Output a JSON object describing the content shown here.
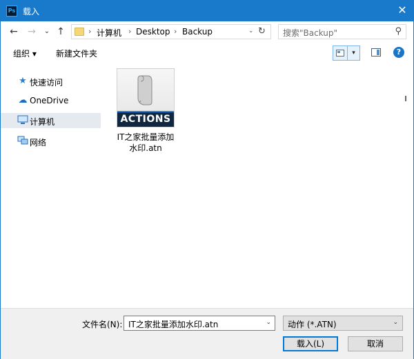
{
  "window": {
    "title": "载入",
    "app_icon": "Ps",
    "close_glyph": "✕"
  },
  "nav": {
    "back_glyph": "←",
    "forward_glyph": "→",
    "recent_glyph": "⌄",
    "up_glyph": "↑",
    "breadcrumb": [
      "计算机",
      "Desktop",
      "Backup"
    ],
    "sep": "›",
    "addr_dropdown": "⌄",
    "refresh_glyph": "↻",
    "search_placeholder": "搜索\"Backup\"",
    "search_glyph": "⚲"
  },
  "toolbar": {
    "organize": "组织 ▾",
    "new_folder": "新建文件夹",
    "view_dd": "▾",
    "help": "?"
  },
  "sidebar": {
    "items": [
      {
        "label": "快速访问",
        "icon": "star-icon",
        "glyph": "★",
        "color": "#2b7fd0"
      },
      {
        "label": "OneDrive",
        "icon": "cloud-icon",
        "glyph": "☁",
        "color": "#1a6fc0"
      },
      {
        "label": "计算机",
        "icon": "computer-icon",
        "glyph": "🖳",
        "color": "#2b7fd0",
        "selected": true
      },
      {
        "label": "网络",
        "icon": "network-icon",
        "glyph": "🖧",
        "color": "#2b7fd0"
      }
    ]
  },
  "files": [
    {
      "thumb_label": "ACTIONS",
      "name": "IT之家批量添加水印.atn"
    }
  ],
  "bottom": {
    "filename_label": "文件名(N):",
    "filename_value": "IT之家批量添加水印.atn",
    "filetype_value": "动作 (*.ATN)",
    "dropdown_glyph": "⌄",
    "load_button": "载入(L)",
    "cancel_button": "取消"
  }
}
